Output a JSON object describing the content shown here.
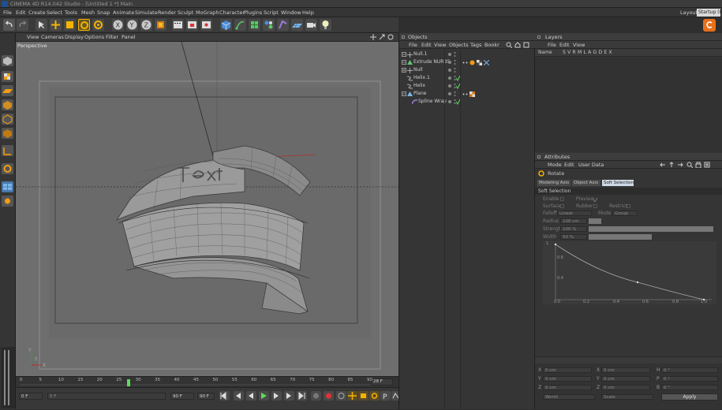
{
  "window": {
    "title": "CINEMA 4D R14.042 Studio - [Untitled 1 *] Main"
  },
  "menubar": {
    "items": [
      "File",
      "Edit",
      "Create",
      "Select",
      "Tools",
      "Mesh",
      "Snap",
      "Animate",
      "Simulate",
      "Render",
      "Sculpt",
      "MoGraph",
      "Character",
      "Plugins",
      "Script",
      "Window",
      "Help"
    ],
    "layout_label": "Layout:",
    "layout_value": "Startup (U"
  },
  "viewport": {
    "menu": [
      "View",
      "Cameras",
      "Display",
      "Options",
      "Filter",
      "Panel"
    ],
    "label": "Perspective",
    "axis_y": "Y",
    "axis_x": "X",
    "axis_z": "Z"
  },
  "timeline": {
    "ticks": [
      "0",
      "5",
      "10",
      "15",
      "20",
      "25",
      "30",
      "35",
      "40",
      "45",
      "50",
      "55",
      "60",
      "65",
      "70",
      "75",
      "80",
      "85",
      "90"
    ],
    "current_frame": "28 F",
    "playhead_label": "28",
    "frame_end": "28 F"
  },
  "transport": {
    "start": "0 F",
    "mid": "0 F",
    "end": "90 F",
    "end2": "90 F"
  },
  "objects": {
    "title": "Objects",
    "menu": [
      "File",
      "Edit",
      "View",
      "Objects",
      "Tags",
      "Bookr"
    ],
    "rows": [
      {
        "name": "Null.1"
      },
      {
        "name": "Extrude NURBS"
      },
      {
        "name": "Null"
      },
      {
        "name": "Helix.1"
      },
      {
        "name": "Helix"
      },
      {
        "name": "Plane"
      },
      {
        "name": "Spline Wrap"
      }
    ]
  },
  "layers": {
    "title": "Layers",
    "menu": [
      "File",
      "Edit",
      "View"
    ],
    "header_name": "Name",
    "header_cols": "S V R M L A G D E X"
  },
  "attributes": {
    "title": "Attributes",
    "menu": [
      "Mode",
      "Edit",
      "User Data"
    ],
    "object_name": "Rotate",
    "tabs": [
      "Modeling Axis",
      "Object Axis",
      "Soft Selection"
    ],
    "active_tab": "Soft Selection",
    "section_title": "Soft Selection",
    "enable": "Enable",
    "preview": "Preview",
    "surface": "Surface",
    "rubber": "Rubber",
    "restrict": "Restrict",
    "falloff_label": "Falloff",
    "falloff_value": "Linear",
    "mode_label": "Mode",
    "mode_value": "Group",
    "radius_label": "Radius",
    "radius_value": "100 cm",
    "strength_label": "Strength",
    "strength_value": "100 %",
    "width_label": "Width",
    "width_value": "50 %",
    "curve": {
      "ticks_y": [
        "1",
        "0.8",
        "0.4"
      ],
      "ticks_x": [
        "0.0",
        "0.2",
        "0.4",
        "0.6",
        "0.8",
        "1.0"
      ]
    },
    "coords": {
      "x_pos": "0 cm",
      "y_pos": "0 cm",
      "z_pos": "0 cm",
      "x_size": "0 cm",
      "y_size": "0 cm",
      "z_size": "0 cm",
      "h_rot": "0 °",
      "p_rot": "0 °",
      "b_rot": "0 °",
      "lbl_x": "X",
      "lbl_y": "Y",
      "lbl_z": "Z",
      "lbl_h": "H",
      "lbl_p": "P",
      "lbl_b": "B",
      "mode1": "World",
      "mode2": "Scale",
      "apply": "Apply"
    }
  },
  "logo_icon": "cinema4d-icon"
}
